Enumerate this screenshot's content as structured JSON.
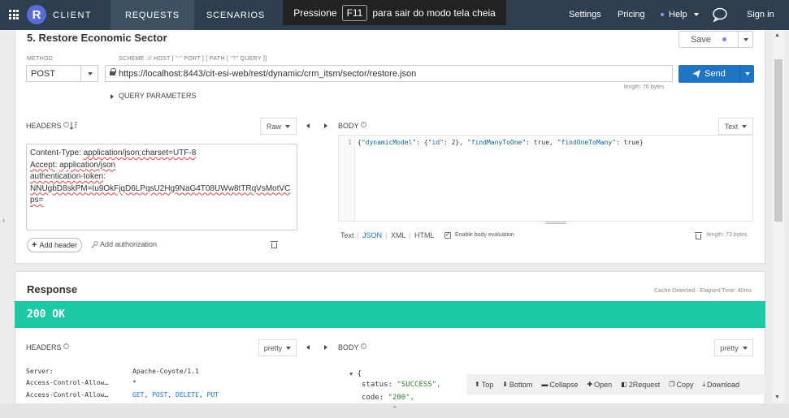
{
  "topbar": {
    "brand": "CLIENT",
    "logo_letter": "R",
    "tabs": [
      {
        "label": "REQUESTS",
        "active": true
      },
      {
        "label": "SCENARIOS",
        "active": false
      }
    ],
    "fullscreen_notice": {
      "before": "Pressione",
      "key": "F11",
      "after": "para sair do modo tela cheia"
    },
    "right_nav": {
      "settings": "Settings",
      "pricing": "Pricing",
      "help": "Help",
      "signin": "Sign in"
    }
  },
  "request": {
    "title": "5. Restore Economic Sector",
    "save_label": "Save",
    "method_label": "METHOD",
    "method": "POST",
    "scheme_hint": "SCHEME :// HOST [ \":\" PORT ] [ PATH [ \"?\" QUERY ]]",
    "url": "https://localhost:8443/cit-esi-web/rest/dynamic/crm_itsm/sector/restore.json",
    "url_length": "length: 76 bytes",
    "send_label": "Send",
    "query_params_label": "QUERY PARAMETERS",
    "headers_label": "HEADERS",
    "headers_mode": "Raw",
    "headers_lines": [
      {
        "key": "Content-Type",
        "value": "application/json;charset=UTF-8"
      },
      {
        "key": "Accept",
        "value": "application/json"
      },
      {
        "key": "authentication-token",
        "value": ""
      },
      {
        "key": "",
        "value": "NNUgbD8skPM=Iu9OkFjqD6LPqsU2Hg9NaG4T08UWw8tTRqVsMotVC"
      },
      {
        "key": "",
        "value": "ps="
      }
    ],
    "add_header_label": "Add header",
    "add_auth_label": "Add authorization",
    "body_label": "BODY",
    "body_mode": "Text",
    "body_line_no": "1",
    "body_code": {
      "open": "{",
      "k1": "\"dynamicModel\"",
      "colon1": ": {",
      "k2": "\"id\"",
      "v2": ": 2},",
      "k3": "\"findManyToOne\"",
      "v3": ": true,",
      "k4": "\"findOneToMany\"",
      "v4": ": true}"
    },
    "body_formats": [
      "Text",
      "JSON",
      "XML",
      "HTML"
    ],
    "body_active_format": "JSON",
    "enable_eval_label": "Enable body evaluation",
    "enable_eval_checked": true,
    "body_length": "length: 73 bytes"
  },
  "response": {
    "title": "Response",
    "meta": "Cache Detected - Elapsed Time: 40ms",
    "status": "200 OK",
    "status_color": "#1dc8a4",
    "headers_label": "HEADERS",
    "headers_mode": "pretty",
    "body_label": "BODY",
    "body_mode": "pretty",
    "headers": [
      {
        "key": "Server:",
        "value": "Apache-Coyote/1.1"
      },
      {
        "key": "Access-Control-Allow…",
        "value": "*"
      },
      {
        "key": "Access-Control-Allow…",
        "value_parts": [
          "GET",
          "POST",
          "DELETE",
          "PUT"
        ]
      }
    ],
    "json_lines": {
      "open": "{",
      "status_key": "status:",
      "status_val": "\"SUCCESS\",",
      "code_key": "code:",
      "code_val": "\"200\","
    },
    "toolbar": [
      "Top",
      "Bottom",
      "Collapse",
      "Open",
      "2Request",
      "Copy",
      "Download"
    ]
  },
  "colors": {
    "topbar": "#2c3e50",
    "accent": "#1f74c4",
    "success": "#1dc8a4"
  }
}
